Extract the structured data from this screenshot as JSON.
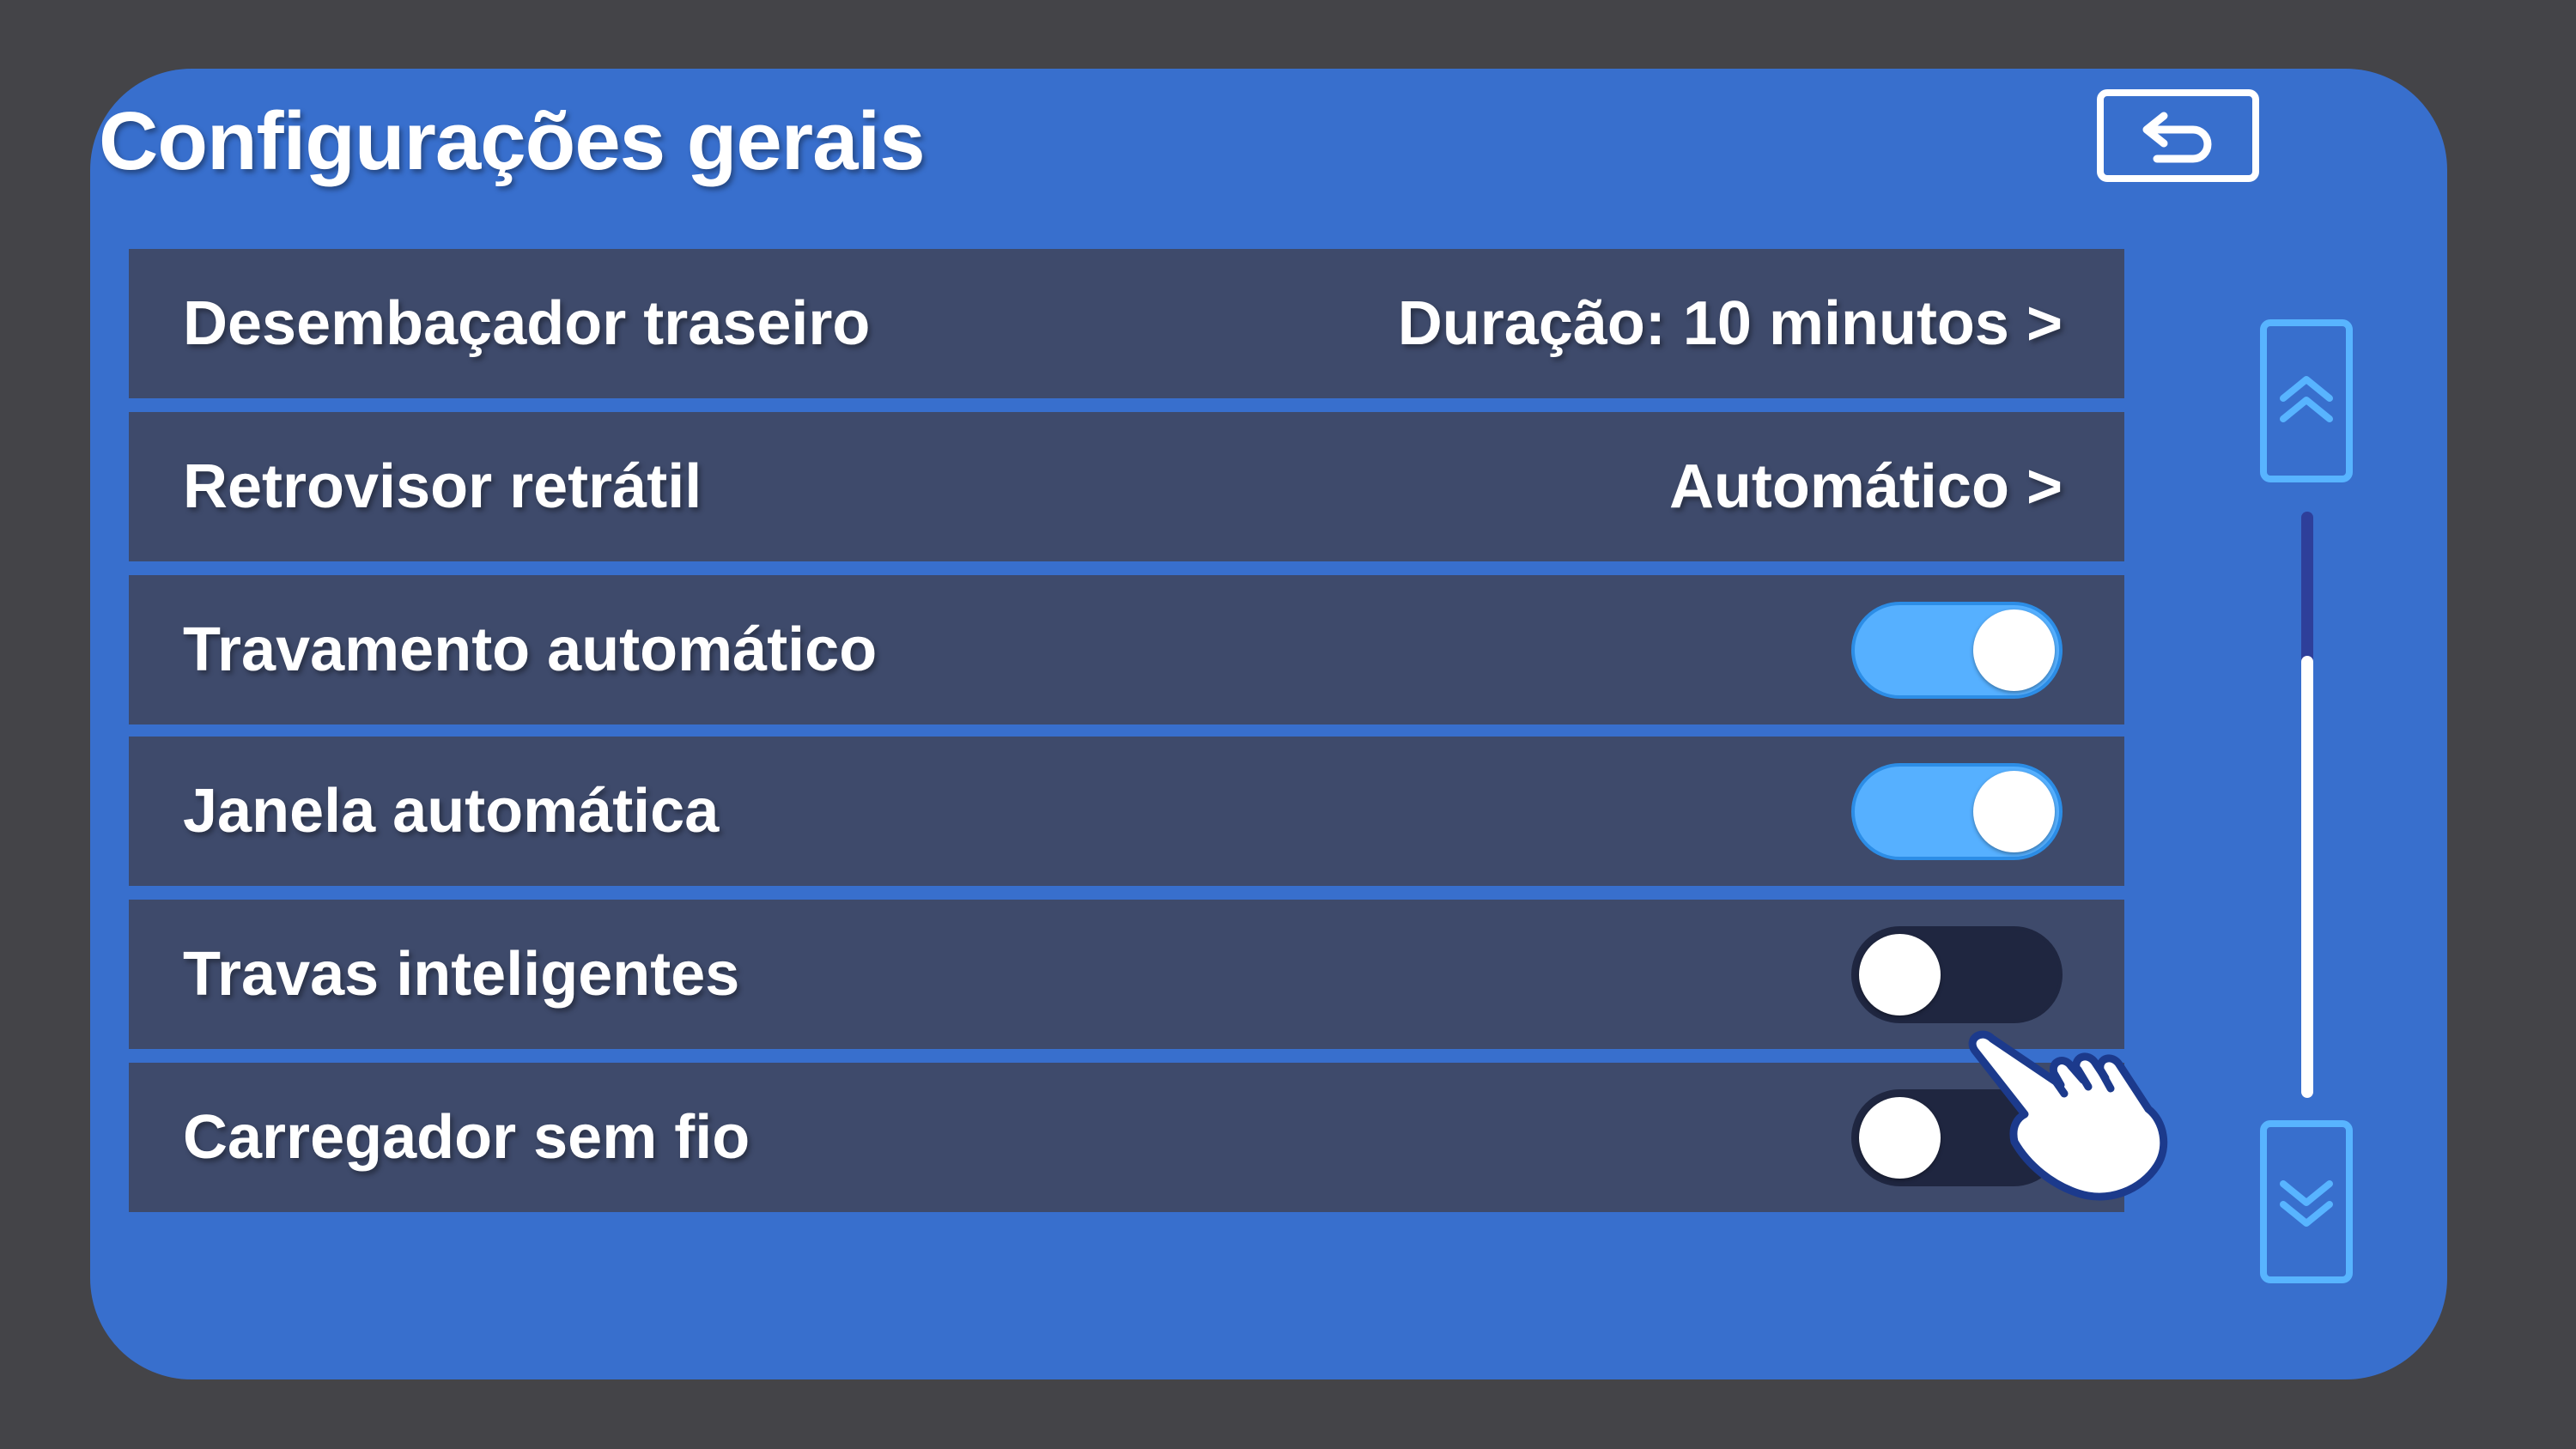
{
  "header": {
    "title": "Configurações gerais",
    "back_icon": "back-return-icon"
  },
  "settings": {
    "rear_defroster": {
      "label": "Desembaçador traseiro",
      "value": "Duração: 10 minutos >"
    },
    "retractable_mirror": {
      "label": "Retrovisor retrátil",
      "value": "Automático >"
    },
    "auto_lock": {
      "label": "Travamento automático",
      "enabled": true
    },
    "auto_window": {
      "label": "Janela automática",
      "enabled": true
    },
    "smart_locks": {
      "label": "Travas inteligentes",
      "enabled": false
    },
    "wireless_charger": {
      "label": "Carregador sem fio",
      "enabled": false
    }
  },
  "scroll": {
    "up_icon": "double-chevron-up-icon",
    "down_icon": "double-chevron-down-icon",
    "position_fraction": 1.0
  },
  "overlay": {
    "pointer_icon": "hand-pointer-icon"
  },
  "colors": {
    "background": "#444448",
    "panel": "#386fcd",
    "row": "#3e4a6b",
    "toggle_on": "#56b0ff",
    "toggle_off": "#1f2640",
    "accent": "#58b4ff",
    "text": "#ffffff"
  }
}
